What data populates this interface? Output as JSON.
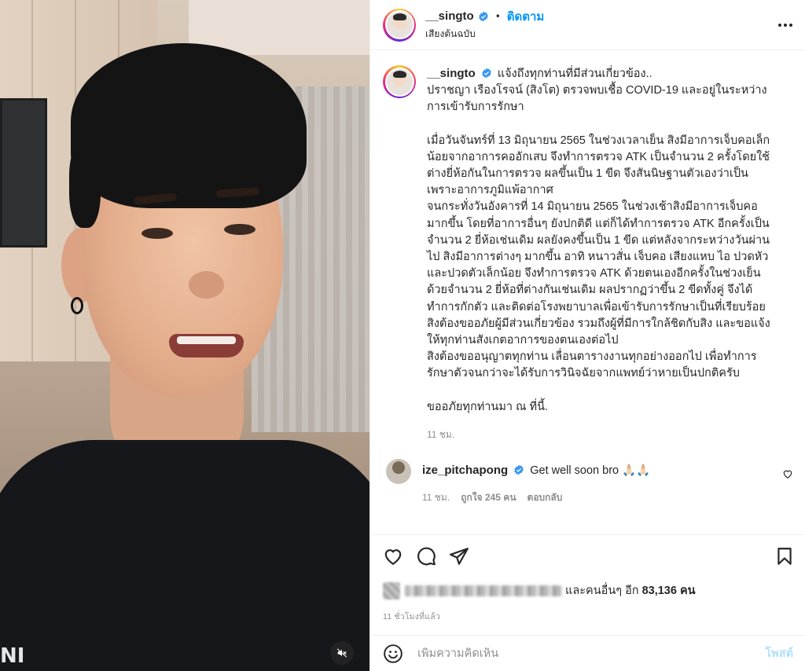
{
  "header": {
    "username": "__singto",
    "follow_label": "ติดตาม",
    "audio_label": "เสียงต้นฉบับ"
  },
  "caption": {
    "username": "__singto",
    "first_line": "แจ้งถึงทุกท่านที่มีส่วนเกี่ยวข้อง..",
    "paragraphs": [
      "ปราชญา เรืองโรจน์ (สิงโต) ตรวจพบเชื้อ COVID-19 และอยู่ในระหว่าง\nการเข้ารับการรักษา",
      "เมื่อวันจันทร์ที่ 13 มิถุนายน 2565 ในช่วงเวลาเย็น สิงมีอาการเจ็บคอเล็ก\nน้อยจากอาการคออักเสบ จึงทำการตรวจ ATK เป็นจำนวน 2 ครั้งโดยใช้\nต่างยี่ห้อกันในการตรวจ ผลขึ้นเป็น 1 ขีด จึงสันนิษฐานตัวเองว่าเป็น\nเพราะอาการภูมิแพ้อากาศ\nจนกระทั่งวันอังคารที่ 14 มิถุนายน 2565 ในช่วงเช้าสิงมีอาการเจ็บคอ\nมากขึ้น โดยที่อาการอื่นๆ ยังปกติดี แต่ก็ได้ทำการตรวจ ATK อีกครั้งเป็น\nจำนวน 2 ยี่ห้อเช่นเดิม ผลยังคงขึ้นเป็น 1 ขีด แต่หลังจากระหว่างวันผ่าน\nไป สิงมีอาการต่างๆ มากขึ้น อาทิ หนาวสั่น เจ็บคอ เสียงแหบ ไอ ปวดหัว\nและปวดตัวเล็กน้อย จึงทำการตรวจ ATK ด้วยตนเองอีกครั้งในช่วงเย็น\nด้วยจำนวน 2 ยี่ห้อที่ต่างกันเช่นเดิม ผลปรากฏว่าขึ้น 2 ขีดทั้งคู่ จึงได้\nทำการกักตัว และติดต่อโรงพยาบาลเพื่อเข้ารับการรักษาเป็นที่เรียบร้อย\nสิงต้องขออภัยผู้มีส่วนเกี่ยวข้อง รวมถึงผู้ที่มีการใกล้ชิดกับสิง และขอแจ้ง\nให้ทุกท่านสังเกตอาการของตนเองต่อไป\nสิงต้องขออนุญาตทุกท่าน เลื่อนตารางงานทุกอย่างออกไป เพื่อทำการ\nรักษาตัวจนกว่าจะได้รับการวินิจฉัยจากแพทย์ว่าหายเป็นปกติครับ",
      "ขออภัยทุกท่านมา ณ ที่นี้."
    ],
    "time": "11 ชม."
  },
  "comment": {
    "username": "ize_pitchapong",
    "text": "Get well soon bro 🙏🏻🙏🏻",
    "time": "11 ชม.",
    "likes": "ถูกใจ 245 คน",
    "reply": "ตอบกลับ"
  },
  "likes": {
    "text": "และคนอื่นๆ อีก",
    "count": "83,136 คน"
  },
  "posted_time": "11 ชั่วโมงที่แล้ว",
  "composer": {
    "placeholder": "เพิ่มความคิดเห็น",
    "post_label": "โพสต์"
  },
  "video": {
    "logo_text": "NI"
  },
  "colors": {
    "accent": "#0095f6",
    "verified": "#3897f0",
    "muted_text": "#8e8e8e"
  },
  "icons": [
    "verified-icon",
    "more-icon",
    "heart-icon",
    "comment-icon",
    "share-icon",
    "bookmark-icon",
    "emoji-icon",
    "mute-icon"
  ]
}
